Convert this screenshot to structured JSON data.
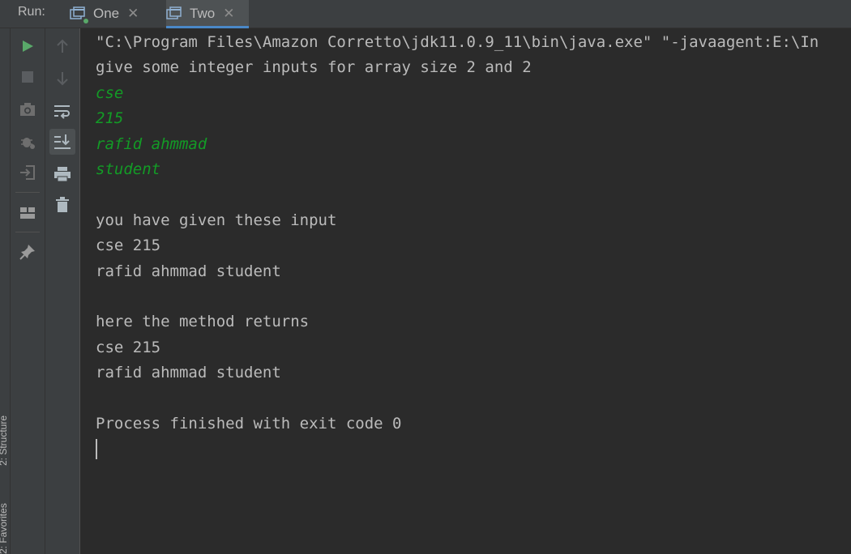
{
  "tabbar": {
    "run_label": "Run:",
    "tabs": [
      {
        "label": "One",
        "close": "✕"
      },
      {
        "label": "Two",
        "close": "✕"
      }
    ]
  },
  "side_strip": {
    "structure_label": "2: Structure",
    "favorites_label": "2: Favorites"
  },
  "toolbar": {
    "left_icons": [
      "run-icon",
      "stop-icon",
      "camera-icon",
      "debug-settings-icon",
      "exit-icon",
      "layout-icon",
      "pin-icon"
    ],
    "right_icons": [
      "up-arrow-icon",
      "down-arrow-icon",
      "soft-wrap-icon",
      "scroll-to-end-icon",
      "print-icon",
      "trash-icon"
    ]
  },
  "console": {
    "lines": [
      {
        "text": "\"C:\\Program Files\\Amazon Corretto\\jdk11.0.9_11\\bin\\java.exe\" \"-javaagent:E:\\In",
        "kind": "output"
      },
      {
        "text": "give some integer inputs for array size 2 and 2",
        "kind": "output"
      },
      {
        "text": "cse",
        "kind": "input"
      },
      {
        "text": "215",
        "kind": "input"
      },
      {
        "text": "rafid ahmmad",
        "kind": "input"
      },
      {
        "text": "student",
        "kind": "input"
      },
      {
        "text": "",
        "kind": "output"
      },
      {
        "text": "you have given these input",
        "kind": "output"
      },
      {
        "text": "cse 215",
        "kind": "output"
      },
      {
        "text": "rafid ahmmad student",
        "kind": "output"
      },
      {
        "text": "",
        "kind": "output"
      },
      {
        "text": "here the method returns",
        "kind": "output"
      },
      {
        "text": "cse 215",
        "kind": "output"
      },
      {
        "text": "rafid ahmmad student",
        "kind": "output"
      },
      {
        "text": "",
        "kind": "output"
      },
      {
        "text": "Process finished with exit code 0",
        "kind": "output"
      }
    ]
  },
  "colors": {
    "background": "#2b2b2b",
    "panel": "#3c3f41",
    "text": "#bbbbbb",
    "input_text": "#139b26",
    "accent": "#4a88c7",
    "run_green": "#59a869"
  }
}
